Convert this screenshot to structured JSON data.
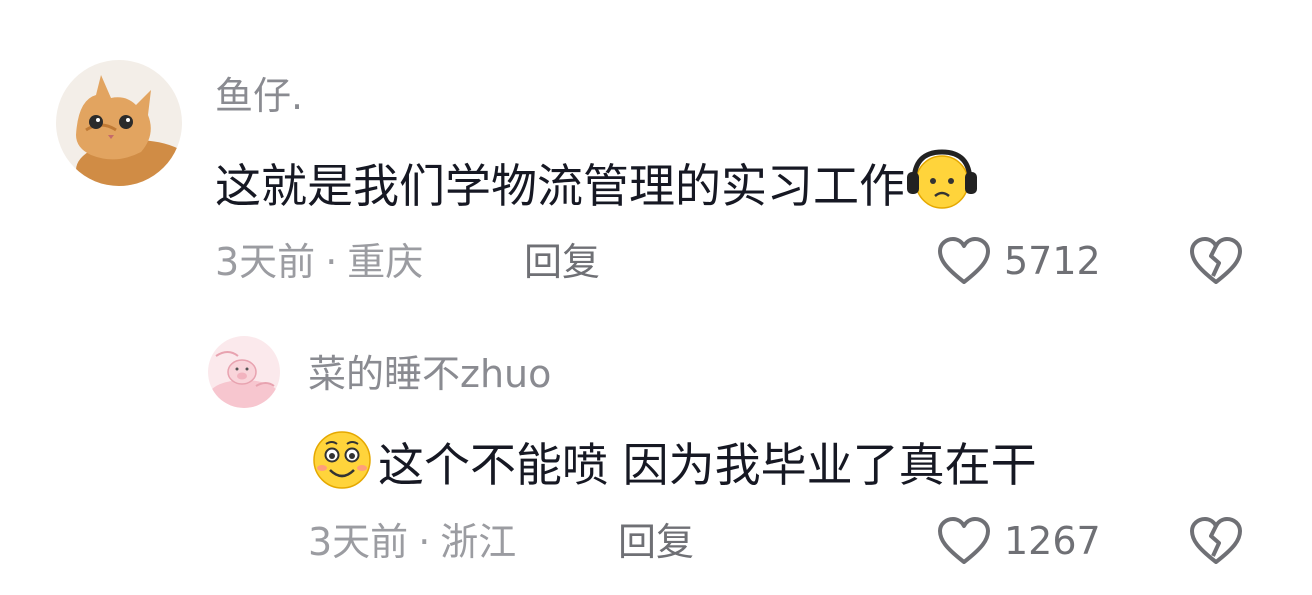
{
  "colors": {
    "username": "#8a8b91",
    "text": "#161823",
    "meta": "#9b9ca1",
    "action": "#6f7075"
  },
  "comments": [
    {
      "username": "鱼仔.",
      "text": "这就是我们学物流管理的实习工作",
      "trailing_emoji": "headphones-sad-face-emoji",
      "time": "3天前",
      "separator": "·",
      "location": "重庆",
      "reply_label": "回复",
      "likes": "5712",
      "avatar_icon": "orange-cat-avatar"
    },
    {
      "username": "菜的睡不zhuo",
      "leading_emoji": "grinning-blush-emoji",
      "text": "这个不能喷 因为我毕业了真在干",
      "time": "3天前",
      "separator": "·",
      "location": "浙江",
      "reply_label": "回复",
      "likes": "1267",
      "avatar_icon": "pink-pig-avatar"
    }
  ]
}
